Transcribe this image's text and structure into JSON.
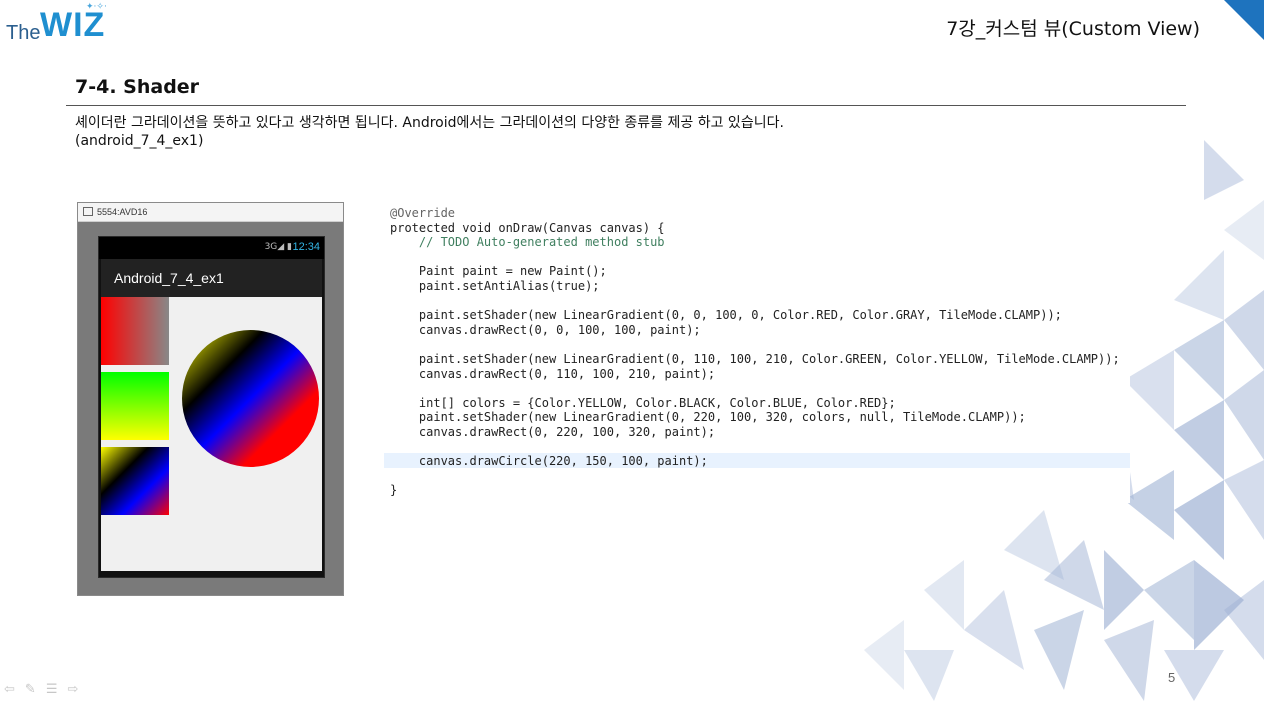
{
  "header": {
    "logo_the": "The",
    "logo_wiz": "WIZ",
    "slide_title": "7강_커스텀 뷰(Custom View)"
  },
  "section": {
    "heading": "7-4. Shader",
    "description_line1": "셰이더란 그라데이션을 뜻하고 있다고 생각하면 됩니다. Android에서는 그라데이션의 다양한 종류를 제공 하고 있습니다.",
    "description_line2": "(android_7_4_ex1)"
  },
  "emulator": {
    "window_title": "5554:AVD16",
    "status_icons": "3G◢ ▮",
    "clock": "12:34",
    "app_title": "Android_7_4_ex1"
  },
  "code": {
    "lines": [
      "@Override",
      "protected void onDraw(Canvas canvas) {",
      "    // TODO Auto-generated method stub",
      "",
      "    Paint paint = new Paint();",
      "    paint.setAntiAlias(true);",
      "",
      "    paint.setShader(new LinearGradient(0, 0, 100, 0, Color.RED, Color.GRAY, TileMode.CLAMP));",
      "    canvas.drawRect(0, 0, 100, 100, paint);",
      "",
      "    paint.setShader(new LinearGradient(0, 110, 100, 210, Color.GREEN, Color.YELLOW, TileMode.CLAMP));",
      "    canvas.drawRect(0, 110, 100, 210, paint);",
      "",
      "    int[] colors = {Color.YELLOW, Color.BLACK, Color.BLUE, Color.RED};",
      "    paint.setShader(new LinearGradient(0, 220, 100, 320, colors, null, TileMode.CLAMP));",
      "    canvas.drawRect(0, 220, 100, 320, paint);",
      "",
      "    canvas.drawCircle(220, 150, 100, paint);",
      "",
      "}"
    ]
  },
  "footer": {
    "page_number": "5",
    "nav_icons": [
      "back-arrow-icon",
      "pen-icon",
      "menu-icon",
      "forward-arrow-icon"
    ]
  },
  "colors": {
    "accent": "#1e73be",
    "clock": "#33b5e5",
    "deco_triangles": "#9fb2d4"
  }
}
